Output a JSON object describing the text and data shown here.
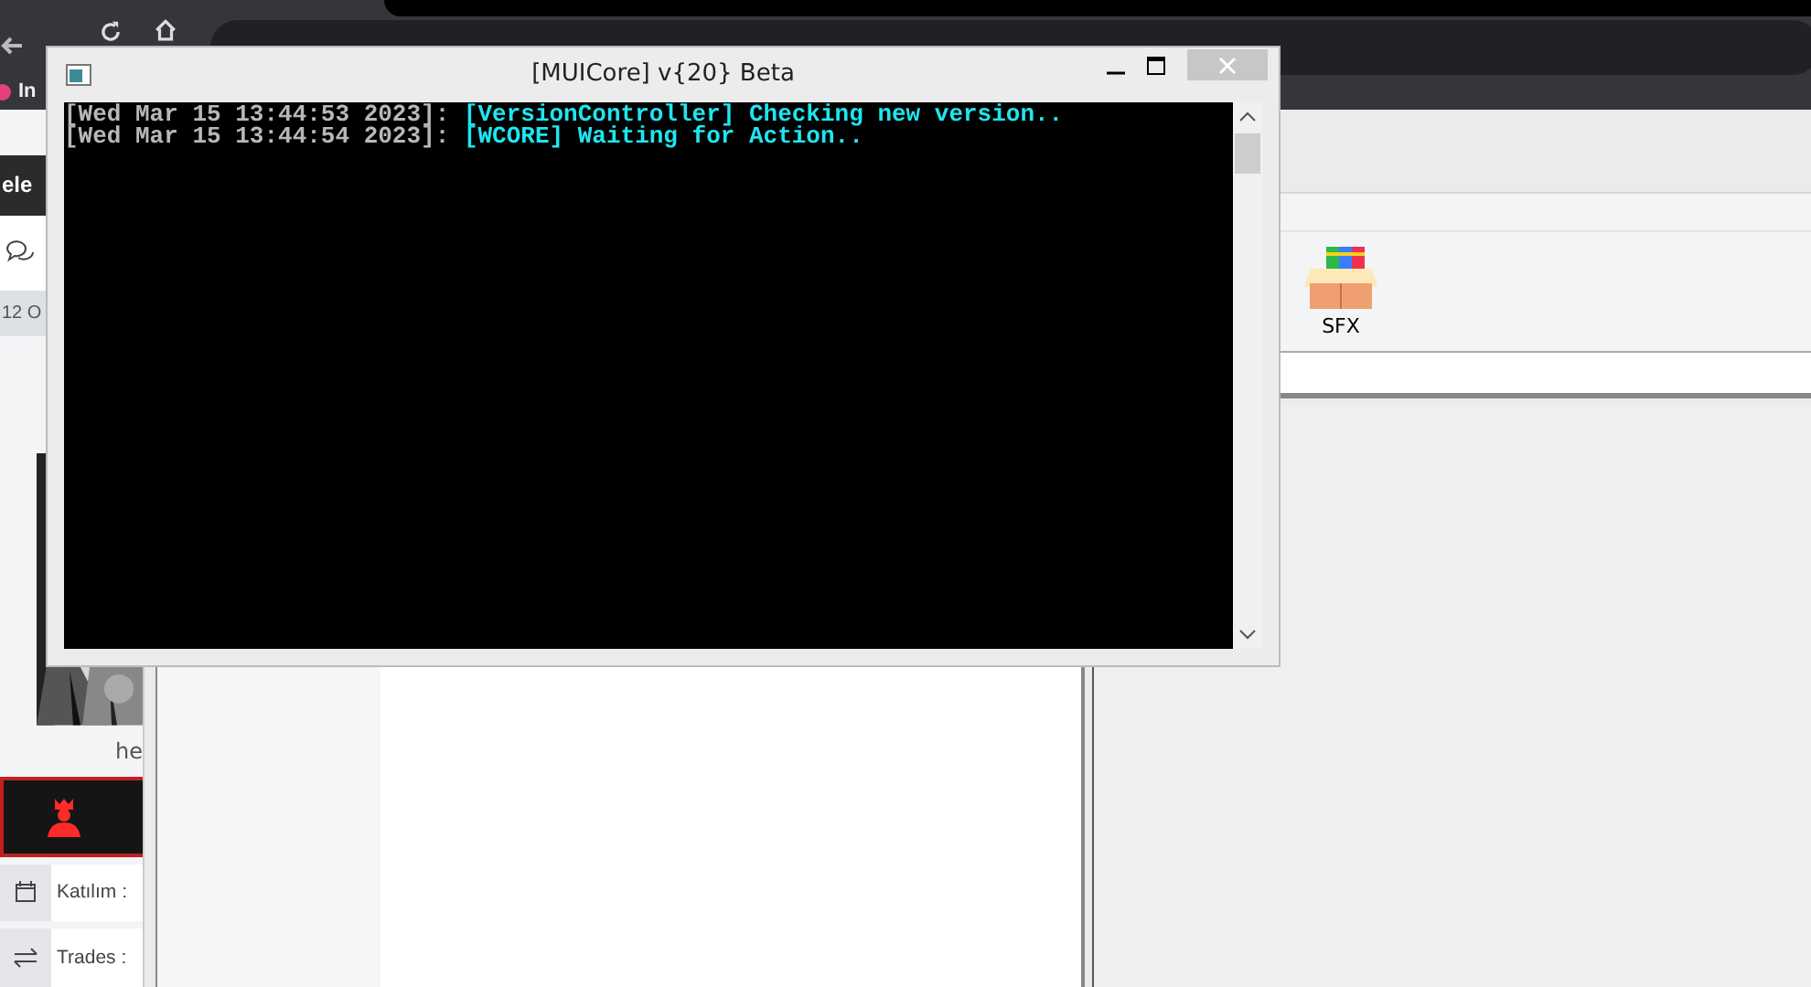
{
  "browser": {
    "bookmark": "In"
  },
  "page": {
    "banner_text": "ele",
    "date_text": "12 O",
    "caption": "he",
    "info_rows": [
      {
        "kind": "calendar",
        "label": "Katılım :"
      },
      {
        "kind": "swap",
        "label": "Trades :"
      }
    ]
  },
  "app": {
    "ribbon_items": [
      {
        "label": "SFX"
      }
    ]
  },
  "console": {
    "title": "[MUICore] v{20} Beta",
    "lines": [
      {
        "timestamp": "[Wed Mar 15 13:44:53 2023]:",
        "message": "[VersionController] Checking new version.."
      },
      {
        "timestamp": "[Wed Mar 15 13:44:54 2023]:",
        "message": "[WCORE] Waiting for Action.."
      }
    ]
  }
}
